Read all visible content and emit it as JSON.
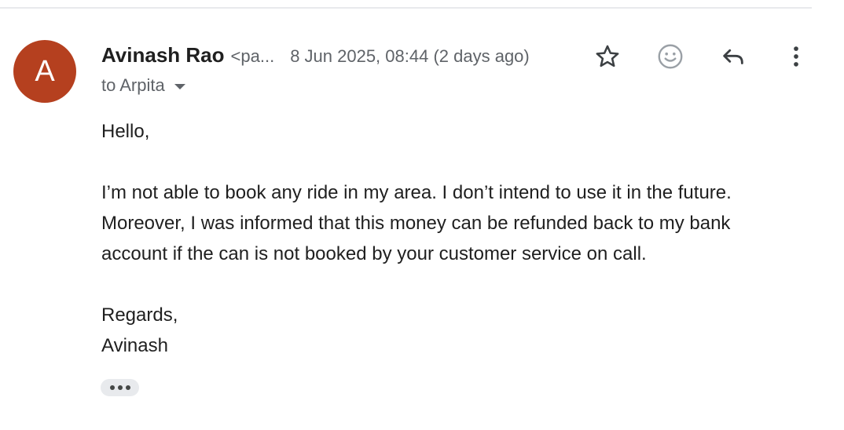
{
  "message": {
    "sender_initial": "A",
    "avatar_color": "#b5401f",
    "sender_name": "Avinash Rao",
    "sender_email_truncated": "<pa...",
    "date": "8 Jun 2025, 08:44 (2 days ago)",
    "recipient": "to Arpita",
    "body": {
      "greeting": "Hello,",
      "paragraph_lines": [
        "I’m not able to book any ride in my area. I don’t intend to use it in the future.",
        "Moreover, I was informed that this money can be refunded back to my bank",
        "account if the can is not booked by your customer service on call."
      ],
      "closing": "Regards,",
      "signature": "Avinash"
    }
  },
  "actions": {
    "star_icon": "star-outline-icon",
    "emoji_icon": "add-reaction-icon",
    "reply_icon": "reply-icon",
    "more_icon": "more-vert-icon",
    "trimmed_content_icon": "more-horiz-icon"
  }
}
